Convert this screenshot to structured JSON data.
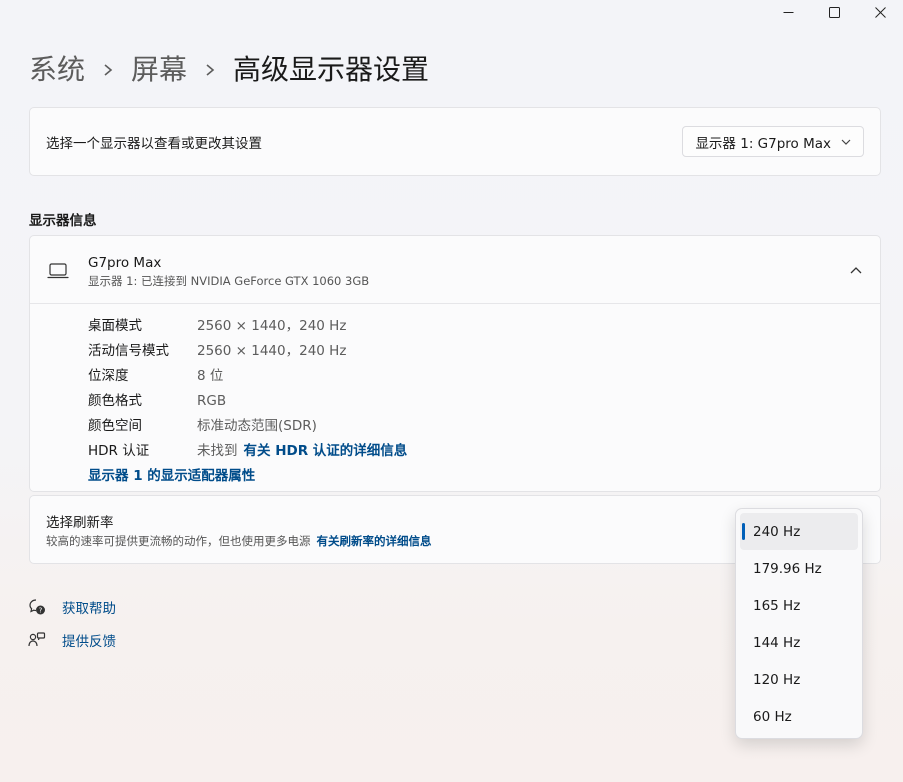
{
  "window_controls": {
    "minimize": "minimize-icon",
    "maximize": "maximize-icon",
    "close": "close-icon"
  },
  "breadcrumb": [
    "系统",
    "屏幕",
    "高级显示器设置"
  ],
  "select_display": {
    "label": "选择一个显示器以查看或更改其设置",
    "dropdown_value": "显示器 1: G7pro Max"
  },
  "display_info": {
    "section_title": "显示器信息",
    "device_name": "G7pro Max",
    "device_sub": "显示器 1: 已连接到 NVIDIA GeForce GTX 1060 3GB",
    "rows": [
      {
        "key": "桌面模式",
        "value": "2560 × 1440，240 Hz"
      },
      {
        "key": "活动信号模式",
        "value": "2560 × 1440，240 Hz"
      },
      {
        "key": "位深度",
        "value": "8 位"
      },
      {
        "key": "颜色格式",
        "value": "RGB"
      },
      {
        "key": "颜色空间",
        "value": "标准动态范围(SDR)"
      }
    ],
    "hdr": {
      "key": "HDR 认证",
      "value": "未找到",
      "link": "有关 HDR 认证的详细信息"
    },
    "adapter_link": "显示器 1 的显示适配器属性"
  },
  "refresh": {
    "title": "选择刷新率",
    "desc": "较高的速率可提供更流畅的动作，但也使用更多电源",
    "link": "有关刷新率的详细信息",
    "options": [
      "240 Hz",
      "179.96 Hz",
      "165 Hz",
      "144 Hz",
      "120 Hz",
      "60 Hz"
    ],
    "selected": "240 Hz"
  },
  "help_links": {
    "get_help": "获取帮助",
    "feedback": "提供反馈"
  },
  "colors": {
    "accent": "#005fb8",
    "link": "#004c8a"
  }
}
